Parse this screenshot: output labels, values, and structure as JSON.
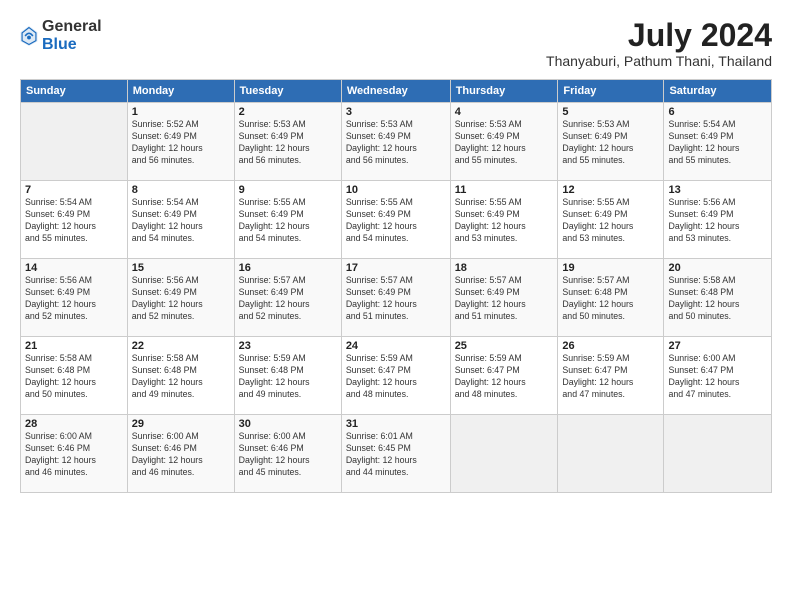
{
  "logo": {
    "general": "General",
    "blue": "Blue"
  },
  "title": "July 2024",
  "location": "Thanyaburi, Pathum Thani, Thailand",
  "days_of_week": [
    "Sunday",
    "Monday",
    "Tuesday",
    "Wednesday",
    "Thursday",
    "Friday",
    "Saturday"
  ],
  "weeks": [
    [
      {
        "day": "",
        "content": ""
      },
      {
        "day": "1",
        "content": "Sunrise: 5:52 AM\nSunset: 6:49 PM\nDaylight: 12 hours\nand 56 minutes."
      },
      {
        "day": "2",
        "content": "Sunrise: 5:53 AM\nSunset: 6:49 PM\nDaylight: 12 hours\nand 56 minutes."
      },
      {
        "day": "3",
        "content": "Sunrise: 5:53 AM\nSunset: 6:49 PM\nDaylight: 12 hours\nand 56 minutes."
      },
      {
        "day": "4",
        "content": "Sunrise: 5:53 AM\nSunset: 6:49 PM\nDaylight: 12 hours\nand 55 minutes."
      },
      {
        "day": "5",
        "content": "Sunrise: 5:53 AM\nSunset: 6:49 PM\nDaylight: 12 hours\nand 55 minutes."
      },
      {
        "day": "6",
        "content": "Sunrise: 5:54 AM\nSunset: 6:49 PM\nDaylight: 12 hours\nand 55 minutes."
      }
    ],
    [
      {
        "day": "7",
        "content": "Sunrise: 5:54 AM\nSunset: 6:49 PM\nDaylight: 12 hours\nand 55 minutes."
      },
      {
        "day": "8",
        "content": "Sunrise: 5:54 AM\nSunset: 6:49 PM\nDaylight: 12 hours\nand 54 minutes."
      },
      {
        "day": "9",
        "content": "Sunrise: 5:55 AM\nSunset: 6:49 PM\nDaylight: 12 hours\nand 54 minutes."
      },
      {
        "day": "10",
        "content": "Sunrise: 5:55 AM\nSunset: 6:49 PM\nDaylight: 12 hours\nand 54 minutes."
      },
      {
        "day": "11",
        "content": "Sunrise: 5:55 AM\nSunset: 6:49 PM\nDaylight: 12 hours\nand 53 minutes."
      },
      {
        "day": "12",
        "content": "Sunrise: 5:55 AM\nSunset: 6:49 PM\nDaylight: 12 hours\nand 53 minutes."
      },
      {
        "day": "13",
        "content": "Sunrise: 5:56 AM\nSunset: 6:49 PM\nDaylight: 12 hours\nand 53 minutes."
      }
    ],
    [
      {
        "day": "14",
        "content": "Sunrise: 5:56 AM\nSunset: 6:49 PM\nDaylight: 12 hours\nand 52 minutes."
      },
      {
        "day": "15",
        "content": "Sunrise: 5:56 AM\nSunset: 6:49 PM\nDaylight: 12 hours\nand 52 minutes."
      },
      {
        "day": "16",
        "content": "Sunrise: 5:57 AM\nSunset: 6:49 PM\nDaylight: 12 hours\nand 52 minutes."
      },
      {
        "day": "17",
        "content": "Sunrise: 5:57 AM\nSunset: 6:49 PM\nDaylight: 12 hours\nand 51 minutes."
      },
      {
        "day": "18",
        "content": "Sunrise: 5:57 AM\nSunset: 6:49 PM\nDaylight: 12 hours\nand 51 minutes."
      },
      {
        "day": "19",
        "content": "Sunrise: 5:57 AM\nSunset: 6:48 PM\nDaylight: 12 hours\nand 50 minutes."
      },
      {
        "day": "20",
        "content": "Sunrise: 5:58 AM\nSunset: 6:48 PM\nDaylight: 12 hours\nand 50 minutes."
      }
    ],
    [
      {
        "day": "21",
        "content": "Sunrise: 5:58 AM\nSunset: 6:48 PM\nDaylight: 12 hours\nand 50 minutes."
      },
      {
        "day": "22",
        "content": "Sunrise: 5:58 AM\nSunset: 6:48 PM\nDaylight: 12 hours\nand 49 minutes."
      },
      {
        "day": "23",
        "content": "Sunrise: 5:59 AM\nSunset: 6:48 PM\nDaylight: 12 hours\nand 49 minutes."
      },
      {
        "day": "24",
        "content": "Sunrise: 5:59 AM\nSunset: 6:47 PM\nDaylight: 12 hours\nand 48 minutes."
      },
      {
        "day": "25",
        "content": "Sunrise: 5:59 AM\nSunset: 6:47 PM\nDaylight: 12 hours\nand 48 minutes."
      },
      {
        "day": "26",
        "content": "Sunrise: 5:59 AM\nSunset: 6:47 PM\nDaylight: 12 hours\nand 47 minutes."
      },
      {
        "day": "27",
        "content": "Sunrise: 6:00 AM\nSunset: 6:47 PM\nDaylight: 12 hours\nand 47 minutes."
      }
    ],
    [
      {
        "day": "28",
        "content": "Sunrise: 6:00 AM\nSunset: 6:46 PM\nDaylight: 12 hours\nand 46 minutes."
      },
      {
        "day": "29",
        "content": "Sunrise: 6:00 AM\nSunset: 6:46 PM\nDaylight: 12 hours\nand 46 minutes."
      },
      {
        "day": "30",
        "content": "Sunrise: 6:00 AM\nSunset: 6:46 PM\nDaylight: 12 hours\nand 45 minutes."
      },
      {
        "day": "31",
        "content": "Sunrise: 6:01 AM\nSunset: 6:45 PM\nDaylight: 12 hours\nand 44 minutes."
      },
      {
        "day": "",
        "content": ""
      },
      {
        "day": "",
        "content": ""
      },
      {
        "day": "",
        "content": ""
      }
    ]
  ]
}
